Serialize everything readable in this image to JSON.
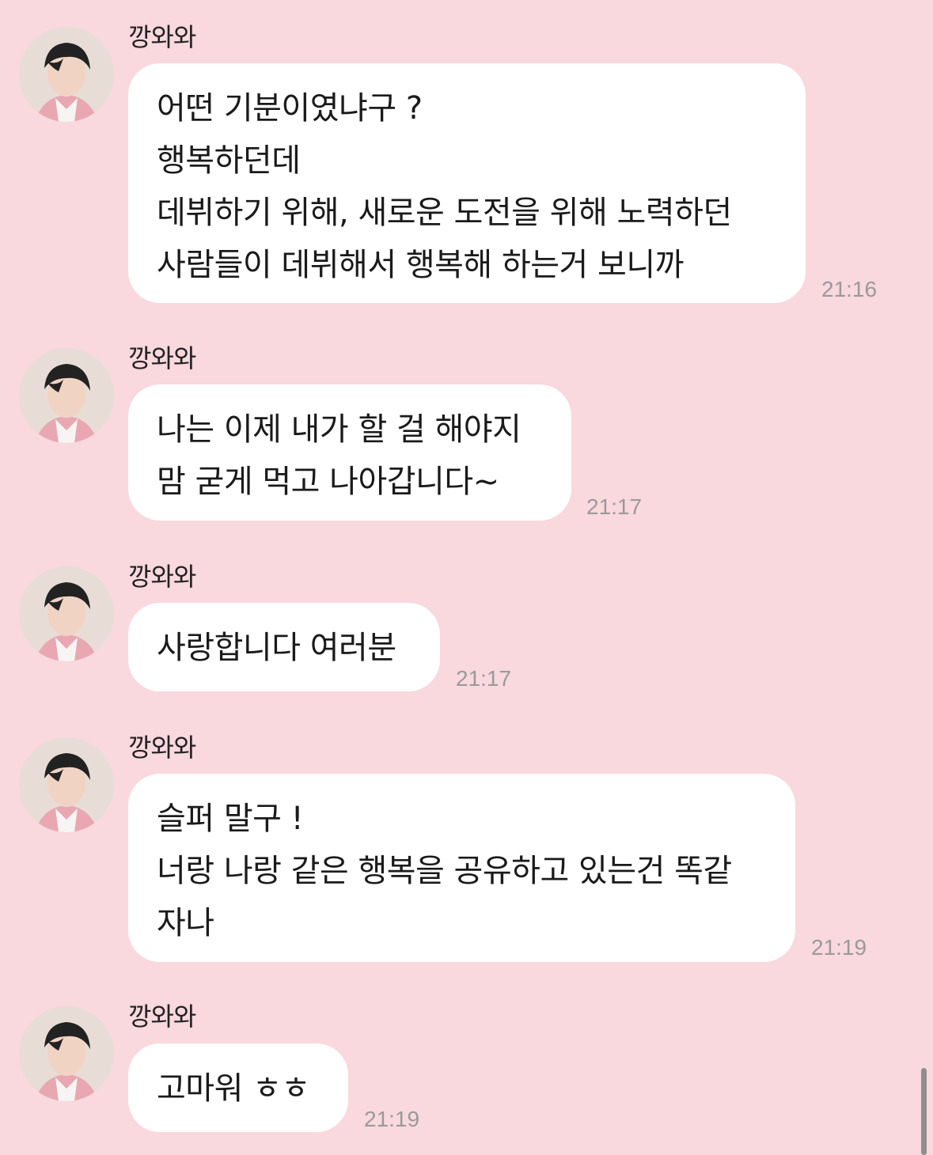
{
  "messages": [
    {
      "sender": "깡와와",
      "lines": [
        "어떤 기분이였냐구 ?",
        "행복하던데",
        "데뷔하기 위해, 새로운 도전을 위해 노력하던",
        "사람들이 데뷔해서 행복해 하는거 보니까"
      ],
      "time": "21:16"
    },
    {
      "sender": "깡와와",
      "lines": [
        "나는 이제 내가 할 걸 해야지",
        "맘 굳게 먹고 나아갑니다~"
      ],
      "time": "21:17"
    },
    {
      "sender": "깡와와",
      "lines": [
        "사랑합니다 여러분"
      ],
      "time": "21:17"
    },
    {
      "sender": "깡와와",
      "lines": [
        "슬퍼 말구 !",
        "너랑 나랑 같은 행복을 공유하고 있는건 똑같",
        "자나"
      ],
      "time": "21:19"
    },
    {
      "sender": "깡와와",
      "lines": [
        "고마워 ㅎㅎ"
      ],
      "time": "21:19"
    }
  ],
  "colors": {
    "background": "#f9d8de",
    "bubble": "#ffffff",
    "timestamp": "#9a9a9a"
  }
}
